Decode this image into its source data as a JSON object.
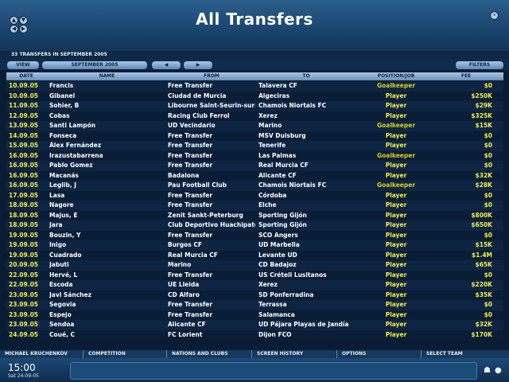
{
  "header": {
    "title": "All Transfers"
  },
  "subinfo": "33 TRANSFERS IN SEPTEMBER 2005",
  "toolbar": {
    "view_label": "VIEW",
    "month_label": "SEPTEMBER 2005",
    "filters_label": "FILTERS"
  },
  "columns": {
    "date": "DATE",
    "name": "NAME",
    "from": "FROM",
    "to": "TO",
    "position": "POSITION/JOB",
    "fee": "FEE"
  },
  "rows": [
    {
      "date": "10.09.05",
      "name": "Francis",
      "from": "Free Transfer",
      "to": "Talavera CF",
      "position": "Goalkeeper",
      "fee": "$0"
    },
    {
      "date": "10.09.05",
      "name": "Gibanel",
      "from": "Ciudad de Murcia",
      "to": "Algeciras",
      "position": "Player",
      "fee": "$250K"
    },
    {
      "date": "11.09.05",
      "name": "Sohier, B",
      "from": "Libourne Saint-Seurin-sur-.",
      "to": "Chamois Niortais FC",
      "position": "Player",
      "fee": "$29K"
    },
    {
      "date": "12.09.05",
      "name": "Cobas",
      "from": "Racing Club Ferrol",
      "to": "Xerez",
      "position": "Player",
      "fee": "$325K"
    },
    {
      "date": "13.09.05",
      "name": "Santi Lampón",
      "from": "UD Vecindario",
      "to": "Marino",
      "position": "Goalkeeper",
      "fee": "$15K"
    },
    {
      "date": "14.09.05",
      "name": "Fonseca",
      "from": "Free Transfer",
      "to": "MSV Duisburg",
      "position": "Player",
      "fee": "$0"
    },
    {
      "date": "15.09.05",
      "name": "Álex Fernández",
      "from": "Free Transfer",
      "to": "Tenerife",
      "position": "Player",
      "fee": "$0"
    },
    {
      "date": "16.09.05",
      "name": "Irazustabarrena",
      "from": "Free Transfer",
      "to": "Las Palmas",
      "position": "Goalkeeper",
      "fee": "$0"
    },
    {
      "date": "16.09.05",
      "name": "Pablo Gomez",
      "from": "Free Transfer",
      "to": "Real Murcia CF",
      "position": "Player",
      "fee": "$0"
    },
    {
      "date": "16.09.05",
      "name": "Macanás",
      "from": "Badalona",
      "to": "Alicante CF",
      "position": "Player",
      "fee": "$32K"
    },
    {
      "date": "16.09.05",
      "name": "Leglib, J",
      "from": "Pau Football Club",
      "to": "Chamois Niortais FC",
      "position": "Goalkeeper",
      "fee": "$28K"
    },
    {
      "date": "17.09.05",
      "name": "Lasa",
      "from": "Free Transfer",
      "to": "Córdoba",
      "position": "Player",
      "fee": "$0"
    },
    {
      "date": "18.09.05",
      "name": "Nagore",
      "from": "Free Transfer",
      "to": "Elche",
      "position": "Player",
      "fee": "$0"
    },
    {
      "date": "18.09.05",
      "name": "Majus, E",
      "from": "Zenit Sankt-Peterburg",
      "to": "Sporting Gijón",
      "position": "Player",
      "fee": "$800K"
    },
    {
      "date": "18.09.05",
      "name": "Jara",
      "from": "Club Deportivo Huachipato",
      "to": "Sporting Gijón",
      "position": "Player",
      "fee": "$650K"
    },
    {
      "date": "19.09.05",
      "name": "Bouzin, Y",
      "from": "Free Transfer",
      "to": "SCO Angers",
      "position": "Player",
      "fee": "$0"
    },
    {
      "date": "19.09.05",
      "name": "Inigo",
      "from": "Burgos CF",
      "to": "UD Marbella",
      "position": "Player",
      "fee": "$15K"
    },
    {
      "date": "19.09.05",
      "name": "Cuadrado",
      "from": "Real Murcia CF",
      "to": "Levante UD",
      "position": "Player",
      "fee": "$1.4M"
    },
    {
      "date": "20.09.05",
      "name": "Jabuti",
      "from": "Marino",
      "to": "CD Badajoz",
      "position": "Player",
      "fee": "$65K"
    },
    {
      "date": "22.09.05",
      "name": "Hervé, L",
      "from": "Free Transfer",
      "to": "US Créteil Lusitanos",
      "position": "Player",
      "fee": "$0"
    },
    {
      "date": "22.09.05",
      "name": "Escoda",
      "from": "UE Lleida",
      "to": "Xerez",
      "position": "Player",
      "fee": "$220K"
    },
    {
      "date": "23.09.05",
      "name": "Javi Sánchez",
      "from": "CD Alfaro",
      "to": "SD Ponferradina",
      "position": "Player",
      "fee": "$35K"
    },
    {
      "date": "23.09.05",
      "name": "Segovia",
      "from": "Free Transfer",
      "to": "Terrassa",
      "position": "Player",
      "fee": "$0"
    },
    {
      "date": "23.09.05",
      "name": "Espejo",
      "from": "Free Transfer",
      "to": "Salamanca",
      "position": "Player",
      "fee": "$0"
    },
    {
      "date": "23.09.05",
      "name": "Sendoa",
      "from": "Alicante CF",
      "to": "UD Pájara Playas de Jandía",
      "position": "Player",
      "fee": "$32K"
    },
    {
      "date": "24.09.05",
      "name": "Coué, C",
      "from": "FC Lorient",
      "to": "Dijon FCO",
      "position": "Player",
      "fee": "$170K"
    }
  ],
  "footer_tabs": {
    "manager": "MICHAEL KRUCHENKOV",
    "competition": "COMPETITION",
    "nations": "NATIONS AND CLUBS",
    "history": "SCREEN HISTORY",
    "options": "OPTIONS",
    "select_team": "SELECT TEAM"
  },
  "footer": {
    "time": "15:00",
    "date": "Sat 24-09-05"
  },
  "icons": {
    "header_left_top": "up-arrow-icon",
    "header_left_bottom": "nav-icon",
    "header_right": "close-icon",
    "prev": "prev-arrow-icon",
    "next": "next-arrow-icon",
    "footer_right": "ball-icon"
  },
  "colors": {
    "accent_yellow": "#f2ee48",
    "header_blue": "#1b4670",
    "row_dark": "#0a1d36"
  }
}
